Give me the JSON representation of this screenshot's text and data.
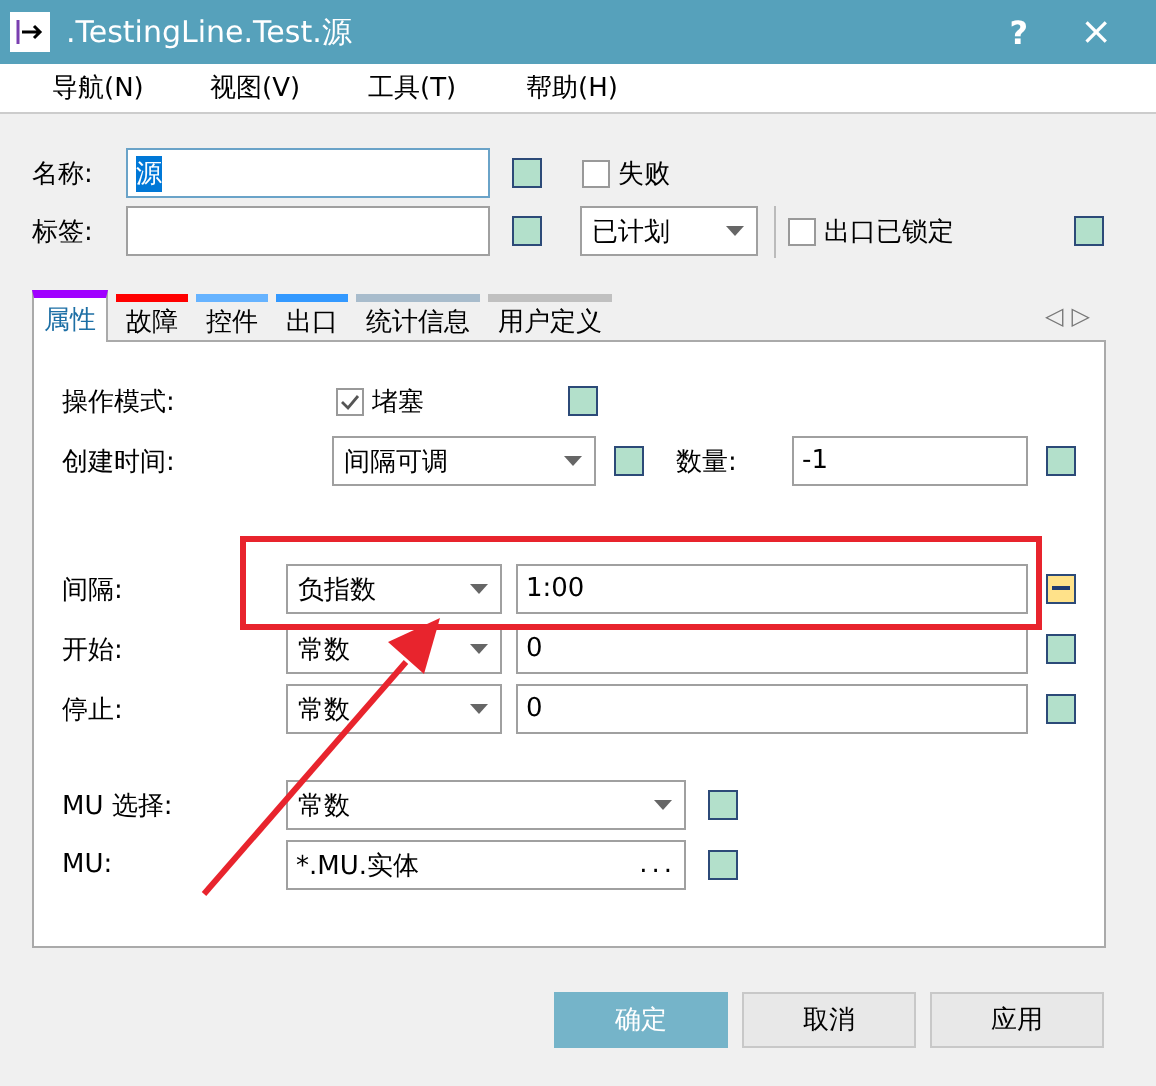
{
  "window": {
    "title": ".TestingLine.Test.源",
    "help_button": "?",
    "close_button": "×"
  },
  "menu": [
    {
      "label": "导航(N)"
    },
    {
      "label": "视图(V)"
    },
    {
      "label": "工具(T)"
    },
    {
      "label": "帮助(H)"
    }
  ],
  "name_field": {
    "label": "名称:",
    "value": "源",
    "text_selected": true,
    "indicator": false
  },
  "failed": {
    "label": "失败",
    "checked": false
  },
  "tag_field": {
    "label": "标签:",
    "indicator": false
  },
  "status": {
    "value": "已计划"
  },
  "exit_locked": {
    "label": "出口已锁定",
    "checked": false,
    "indicator": false
  },
  "tabs": [
    {
      "label": "属性",
      "color": "#a000ff",
      "selected": true
    },
    {
      "label": "故障",
      "color": "#ff0000",
      "selected": false
    },
    {
      "label": "控件",
      "color": "#66b3ff",
      "selected": false
    },
    {
      "label": "出口",
      "color": "#3399ff",
      "selected": false
    },
    {
      "label": "统计信息",
      "color": "#a8bccc",
      "selected": false
    },
    {
      "label": "用户定义",
      "color": "#c0c0c0",
      "selected": false
    }
  ],
  "tab_scroll": [
    "◁",
    "▷"
  ],
  "sections": [
    [
      {
        "kind": "checkbox",
        "label": "操作模式:",
        "option": "堵塞",
        "checked": true,
        "indicator": false
      },
      {
        "kind": "dropdown",
        "label": "创建时间:",
        "value": "间隔可调",
        "indicator": false,
        "extra": {
          "label": "数量:",
          "value": "-1",
          "indicator": false
        }
      }
    ],
    [
      {
        "kind": "distribution",
        "label": "间隔:",
        "type": "负指数",
        "value": "1:00",
        "indicator": true
      },
      {
        "kind": "distribution",
        "label": "开始:",
        "type": "常数",
        "value": "0",
        "indicator": false
      },
      {
        "kind": "distribution",
        "label": "停止:",
        "type": "常数",
        "value": "0",
        "indicator": false
      }
    ],
    [
      {
        "kind": "select",
        "label": "MU 选择:",
        "value": "常数",
        "indicator": false
      },
      {
        "kind": "browse",
        "label": "MU:",
        "value": "*.MU.实体",
        "button": "...",
        "indicator": false
      }
    ]
  ],
  "buttons": [
    {
      "label": "确定",
      "primary": true
    },
    {
      "label": "取消",
      "primary": false
    },
    {
      "label": "应用",
      "primary": false
    }
  ],
  "annotations": {
    "highlight_frame": true,
    "arrow": true
  }
}
